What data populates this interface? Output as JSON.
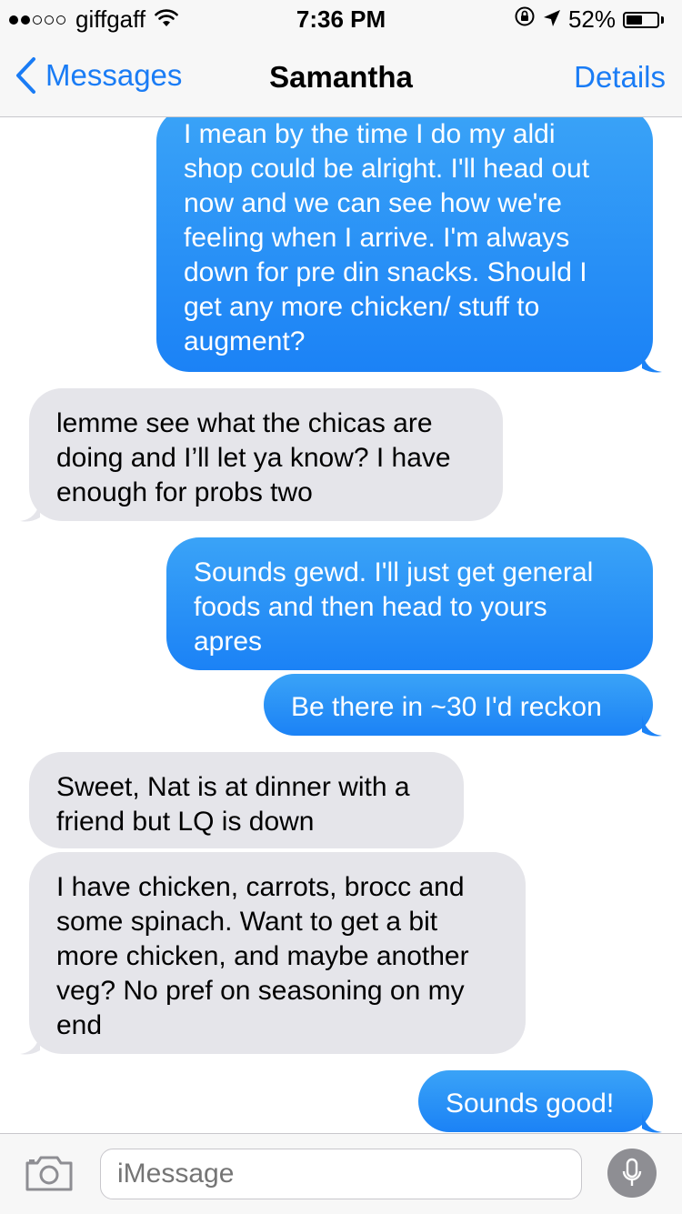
{
  "status_bar": {
    "carrier": "giffgaff",
    "signal_bars_filled": 2,
    "signal_bars_total": 5,
    "time": "7:36 PM",
    "battery_percent": "52%",
    "battery_level": 0.52,
    "icons": [
      "wifi-icon",
      "rotation-lock-icon",
      "location-icon",
      "battery-icon"
    ]
  },
  "nav": {
    "back_label": "Messages",
    "title": "Samantha",
    "details_label": "Details"
  },
  "messages": [
    {
      "direction": "sent",
      "lines": [
        "I mean by the time I do my aldi",
        "shop could be alright. I'll head out",
        "now and we can see how we're",
        "feeling when I arrive. I'm always",
        "down for pre din snacks. Should I",
        "get any more chicken/ stuff to",
        "augment?"
      ]
    },
    {
      "direction": "received",
      "lines": [
        "lemme see what the chicas are",
        "doing and I’ll let ya know? I have",
        "enough for probs two"
      ]
    },
    {
      "direction": "sent",
      "lines": [
        "Sounds gewd. I'll just get general",
        "foods and then head to yours",
        "apres"
      ]
    },
    {
      "direction": "sent",
      "lines": [
        "Be there in ~30 I'd reckon"
      ]
    },
    {
      "direction": "received",
      "lines": [
        "Sweet, Nat is at dinner with a",
        "friend but LQ is down"
      ]
    },
    {
      "direction": "received",
      "lines": [
        "I have chicken, carrots, brocc and",
        "some spinach. Want to get a bit",
        "more chicken, and maybe another",
        "veg? No pref on seasoning on my",
        "end"
      ]
    },
    {
      "direction": "sent",
      "lines": [
        "Sounds good!"
      ]
    }
  ],
  "input": {
    "placeholder": "iMessage"
  },
  "colors": {
    "accent": "#1a7cf5",
    "sent_bubble_top": "#3aa3f7",
    "sent_bubble_bottom": "#1b82f6",
    "received_bubble": "#e5e5ea",
    "bar_background": "#f7f7f7"
  }
}
